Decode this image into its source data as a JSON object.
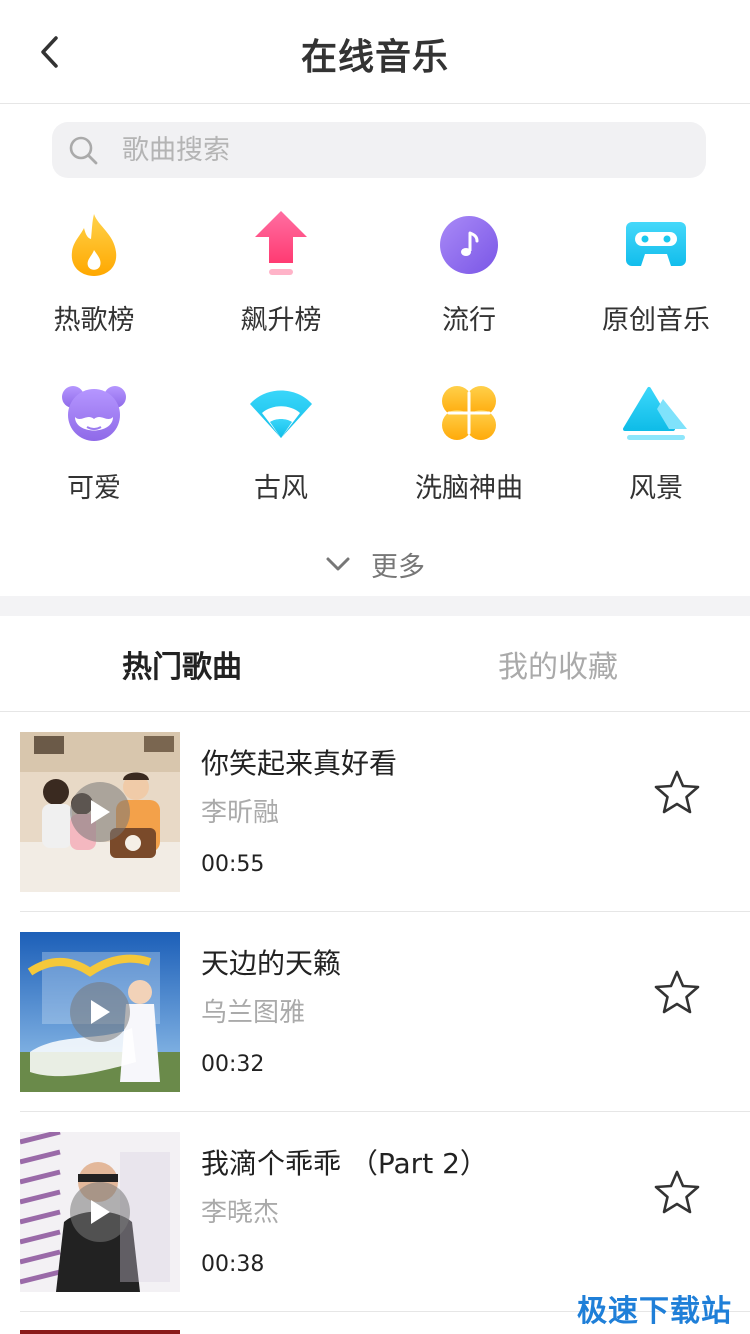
{
  "header": {
    "title": "在线音乐",
    "back_icon": "chevron-left-icon"
  },
  "search": {
    "placeholder": "歌曲搜索",
    "icon": "search-icon"
  },
  "categories": [
    {
      "label": "热歌榜",
      "icon": "flame-icon",
      "color": "#ffb400"
    },
    {
      "label": "飙升榜",
      "icon": "arrow-up-icon",
      "color": "#ff4f86"
    },
    {
      "label": "流行",
      "icon": "music-note-icon",
      "color": "#8e6cf0"
    },
    {
      "label": "原创音乐",
      "icon": "cassette-icon",
      "color": "#1ec8f5"
    },
    {
      "label": "可爱",
      "icon": "bear-face-icon",
      "color": "#a07cf5"
    },
    {
      "label": "古风",
      "icon": "fan-icon",
      "color": "#19c8ee"
    },
    {
      "label": "洗脑神曲",
      "icon": "clover-icon",
      "color": "#ffb400"
    },
    {
      "label": "风景",
      "icon": "mountain-icon",
      "color": "#19c8ee"
    }
  ],
  "more": {
    "label": "更多",
    "icon": "chevron-down-icon"
  },
  "tabs": [
    {
      "label": "热门歌曲",
      "active": true
    },
    {
      "label": "我的收藏",
      "active": false
    }
  ],
  "songs": [
    {
      "title": "你笑起来真好看",
      "artist": "李昕融",
      "duration": "00:55"
    },
    {
      "title": "天边的天籁",
      "artist": "乌兰图雅",
      "duration": "00:32"
    },
    {
      "title": "我滴个乖乖 （Part 2）",
      "artist": "李晓杰",
      "duration": "00:38"
    }
  ],
  "watermark": "极速下载站"
}
